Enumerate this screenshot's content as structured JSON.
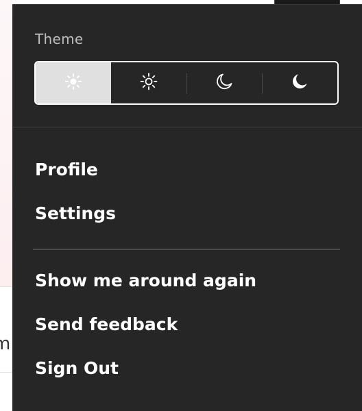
{
  "background": {
    "partial_text": "m"
  },
  "menu": {
    "theme_label": "Theme",
    "theme_options": [
      {
        "icon": "sun-small-icon",
        "selected": true
      },
      {
        "icon": "sun-outline-icon",
        "selected": false
      },
      {
        "icon": "moon-outline-icon",
        "selected": false
      },
      {
        "icon": "moon-filled-icon",
        "selected": false
      }
    ],
    "items_group1": [
      "Profile",
      "Settings"
    ],
    "items_group2": [
      "Show me around again",
      "Send feedback",
      "Sign Out"
    ]
  },
  "colors": {
    "menu_bg": "#262626",
    "active_segment": "#e0e0e0",
    "text": "#ffffff",
    "label": "#bdbdbd"
  }
}
